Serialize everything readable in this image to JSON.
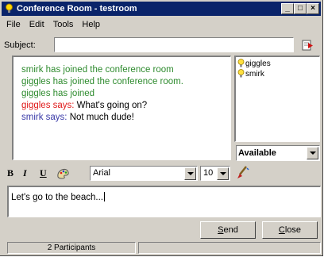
{
  "window": {
    "title": "Conference Room - testroom"
  },
  "menu": [
    "File",
    "Edit",
    "Tools",
    "Help"
  ],
  "subject": {
    "label": "Subject:",
    "value": ""
  },
  "chat": {
    "lines": [
      {
        "type": "system",
        "text": "smirk has joined the conference room"
      },
      {
        "type": "system",
        "text": "giggles has joined the conference room."
      },
      {
        "type": "system",
        "text": "giggles has joined"
      },
      {
        "type": "message",
        "speaker": "giggles says:",
        "text": " What's going on?"
      },
      {
        "type": "message",
        "speaker": "smirk says:",
        "text": " Not much dude!"
      }
    ]
  },
  "participants": [
    {
      "name": "giggles"
    },
    {
      "name": "smirk"
    }
  ],
  "status": {
    "selected": "Available"
  },
  "toolbar": {
    "bold": "B",
    "italic": "I",
    "underline": "U",
    "font": "Arial",
    "size": "10"
  },
  "compose": {
    "value": "Let's go to the beach..."
  },
  "buttons": {
    "send_prefix": "",
    "send_key": "S",
    "send_rest": "end",
    "close_key": "C",
    "close_rest": "lose"
  },
  "statusbar": {
    "participants": "2 Participants"
  },
  "colors": {
    "system": "#2e8b2e",
    "speaker_giggles": "#e01818",
    "speaker_smirk": "#3a3aa8",
    "titlebar": "#0a246a"
  },
  "icons": [
    "bulb-icon",
    "send-arrow-icon",
    "color-palette-icon",
    "format-brush-icon"
  ]
}
